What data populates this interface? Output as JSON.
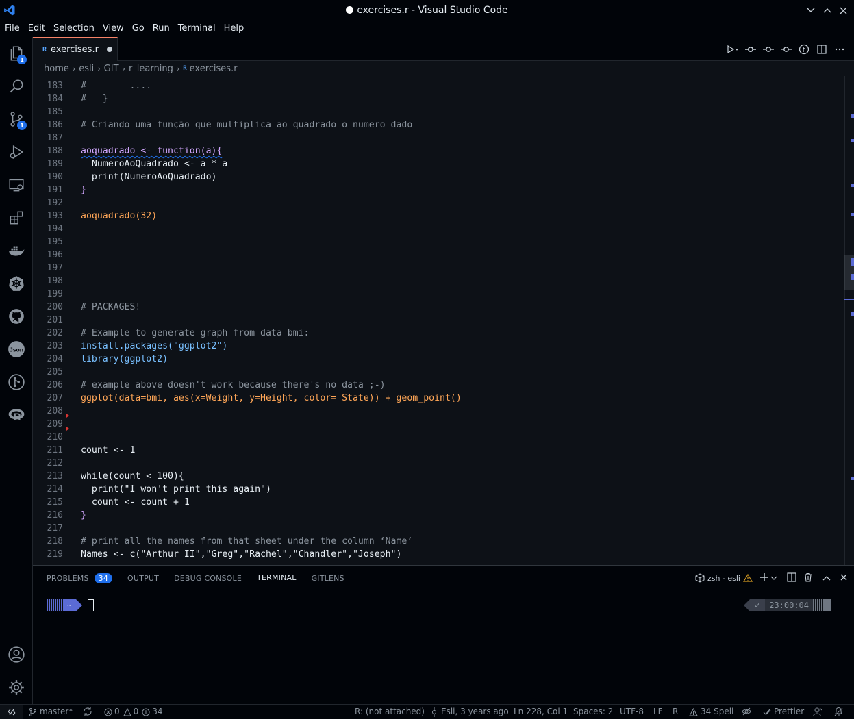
{
  "window": {
    "title": "exercises.r - Visual Studio Code",
    "controls": [
      "chevron-down",
      "chevron-up",
      "close"
    ]
  },
  "menu": [
    "File",
    "Edit",
    "Selection",
    "View",
    "Go",
    "Run",
    "Terminal",
    "Help"
  ],
  "activity": {
    "explorer_badge": "1",
    "scm_badge": "1",
    "icons": [
      "files-icon",
      "search-icon",
      "source-control-icon",
      "run-debug-icon",
      "remote-explorer-icon",
      "extensions-icon",
      "docker-icon",
      "kubernetes-icon",
      "github-icon",
      "json-icon",
      "gitlens-icon",
      "r-icon",
      "account-icon",
      "settings-gear-icon"
    ],
    "json_label": "Json",
    "r_label": "R"
  },
  "tab": {
    "icon_text": "R",
    "label": "exercises.r",
    "modified": true
  },
  "breadcrumb": [
    "home",
    "esli",
    "GIT",
    "r_learning",
    "exercises.r"
  ],
  "breadcrumb_icon": "R",
  "editor": {
    "lines": [
      {
        "n": "183",
        "t": "#        ...."
      },
      {
        "n": "184",
        "t": "#   }"
      },
      {
        "n": "185",
        "t": ""
      },
      {
        "n": "186",
        "t": "# Criando uma função que multiplica ao quadrado o numero dado"
      },
      {
        "n": "187",
        "t": ""
      },
      {
        "n": "188",
        "t": "aoquadrado <- function(a){"
      },
      {
        "n": "189",
        "t": "  NumeroAoQuadrado <- a * a"
      },
      {
        "n": "190",
        "t": "  print(NumeroAoQuadrado)"
      },
      {
        "n": "191",
        "t": "}"
      },
      {
        "n": "192",
        "t": ""
      },
      {
        "n": "193",
        "t": "aoquadrado(32)"
      },
      {
        "n": "194",
        "t": ""
      },
      {
        "n": "195",
        "t": ""
      },
      {
        "n": "196",
        "t": ""
      },
      {
        "n": "197",
        "t": ""
      },
      {
        "n": "198",
        "t": ""
      },
      {
        "n": "199",
        "t": ""
      },
      {
        "n": "200",
        "t": "# PACKAGES!"
      },
      {
        "n": "201",
        "t": ""
      },
      {
        "n": "202",
        "t": "# Example to generate graph from data bmi:"
      },
      {
        "n": "203",
        "t": "install.packages(\"ggplot2\")"
      },
      {
        "n": "204",
        "t": "library(ggplot2)"
      },
      {
        "n": "205",
        "t": ""
      },
      {
        "n": "206",
        "t": "# example above doesn't work because there's no data ;-)"
      },
      {
        "n": "207",
        "t": "ggplot(data=bmi, aes(x=Weight, y=Height, color= State)) + geom_point()"
      },
      {
        "n": "208",
        "t": ""
      },
      {
        "n": "209",
        "t": ""
      },
      {
        "n": "210",
        "t": ""
      },
      {
        "n": "211",
        "t": "count <- 1"
      },
      {
        "n": "212",
        "t": ""
      },
      {
        "n": "213",
        "t": "while(count < 100){"
      },
      {
        "n": "214",
        "t": "  print(\"I won't print this again\")"
      },
      {
        "n": "215",
        "t": "  count <- count + 1"
      },
      {
        "n": "216",
        "t": "}"
      },
      {
        "n": "217",
        "t": ""
      },
      {
        "n": "218",
        "t": "# print all the names from that sheet under the column ‘Name’"
      },
      {
        "n": "219",
        "t": "Names <- c(\"Arthur II\",\"Greg\",\"Rachel\",\"Chandler\",\"Joseph\")"
      }
    ]
  },
  "panel": {
    "tabs": [
      "PROBLEMS",
      "OUTPUT",
      "DEBUG CONSOLE",
      "TERMINAL",
      "GITLENS"
    ],
    "active_tab": "TERMINAL",
    "problems_count": "34",
    "terminal_name": "zsh - esli",
    "prompt_dir": "~",
    "right_prompt_time": "23:00:04",
    "right_prompt_status": "✓"
  },
  "statusbar": {
    "branch": "master*",
    "errors": "0",
    "warnings": "0",
    "infos": "34",
    "r_status": "R: (not attached)",
    "blame": "Esli, 3 years ago",
    "cursor": "Ln 228, Col 1",
    "spaces": "Spaces: 2",
    "encoding": "UTF-8",
    "eol": "LF",
    "language": "R",
    "spell": "34 Spell",
    "prettier": "Prettier"
  },
  "colors": {
    "accent": "#1f6feb",
    "tab_border": "#f78166",
    "background": "#0d1117"
  }
}
